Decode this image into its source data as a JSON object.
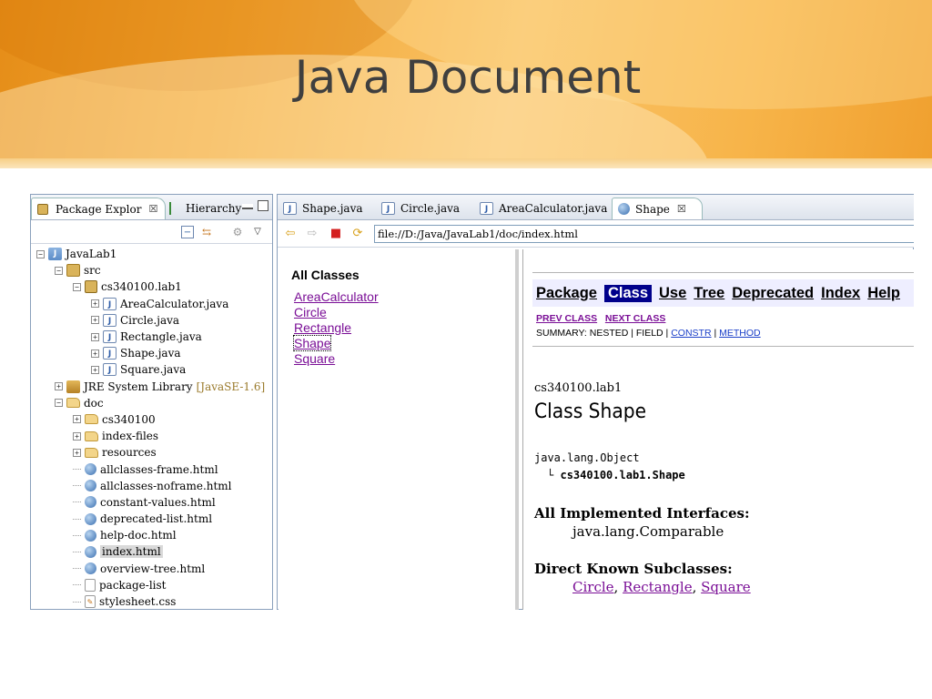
{
  "slide": {
    "title": "Java Document"
  },
  "left_view": {
    "tabs": [
      {
        "label": "Package Explor",
        "close": "☒"
      },
      {
        "label": "Hierarchy"
      }
    ],
    "tree": [
      {
        "label": "JavaLab1"
      },
      {
        "label": "src"
      },
      {
        "label": "cs340100.lab1"
      },
      {
        "label": "AreaCalculator.java"
      },
      {
        "label": "Circle.java"
      },
      {
        "label": "Rectangle.java"
      },
      {
        "label": "Shape.java"
      },
      {
        "label": "Square.java"
      },
      {
        "label": "JRE System Library",
        "suffix": "[JavaSE-1.6]"
      },
      {
        "label": "doc"
      },
      {
        "label": "cs340100"
      },
      {
        "label": "index-files"
      },
      {
        "label": "resources"
      },
      {
        "label": "allclasses-frame.html"
      },
      {
        "label": "allclasses-noframe.html"
      },
      {
        "label": "constant-values.html"
      },
      {
        "label": "deprecated-list.html"
      },
      {
        "label": "help-doc.html"
      },
      {
        "label": "index.html"
      },
      {
        "label": "overview-tree.html"
      },
      {
        "label": "package-list"
      },
      {
        "label": "stylesheet.css"
      }
    ]
  },
  "editor": {
    "tabs": [
      "Shape.java",
      "Circle.java",
      "AreaCalculator.java",
      "Shape"
    ],
    "url": "file://D:/Java/JavaLab1/doc/index.html"
  },
  "all_classes": {
    "heading": "All Classes",
    "items": [
      "AreaCalculator",
      "Circle",
      "Rectangle",
      "Shape",
      "Square"
    ]
  },
  "doc": {
    "nav": [
      "Package",
      "Class",
      "Use",
      "Tree",
      "Deprecated",
      "Index",
      "Help"
    ],
    "prev_class": "PREV CLASS",
    "next_class": "NEXT CLASS",
    "summary_prefix": "SUMMARY: NESTED | FIELD |",
    "constr": "CONSTR",
    "sep": "|",
    "method": "METHOD",
    "package": "cs340100.lab1",
    "class_title": "Class Shape",
    "hierarchy_root": "java.lang.Object",
    "hierarchy_child": "cs340100.lab1.Shape",
    "interfaces_heading": "All Implemented Interfaces:",
    "interfaces_value": "java.lang.Comparable",
    "subclasses_heading": "Direct Known Subclasses:",
    "subclasses": [
      "Circle",
      "Rectangle",
      "Square"
    ],
    "comma": ","
  }
}
